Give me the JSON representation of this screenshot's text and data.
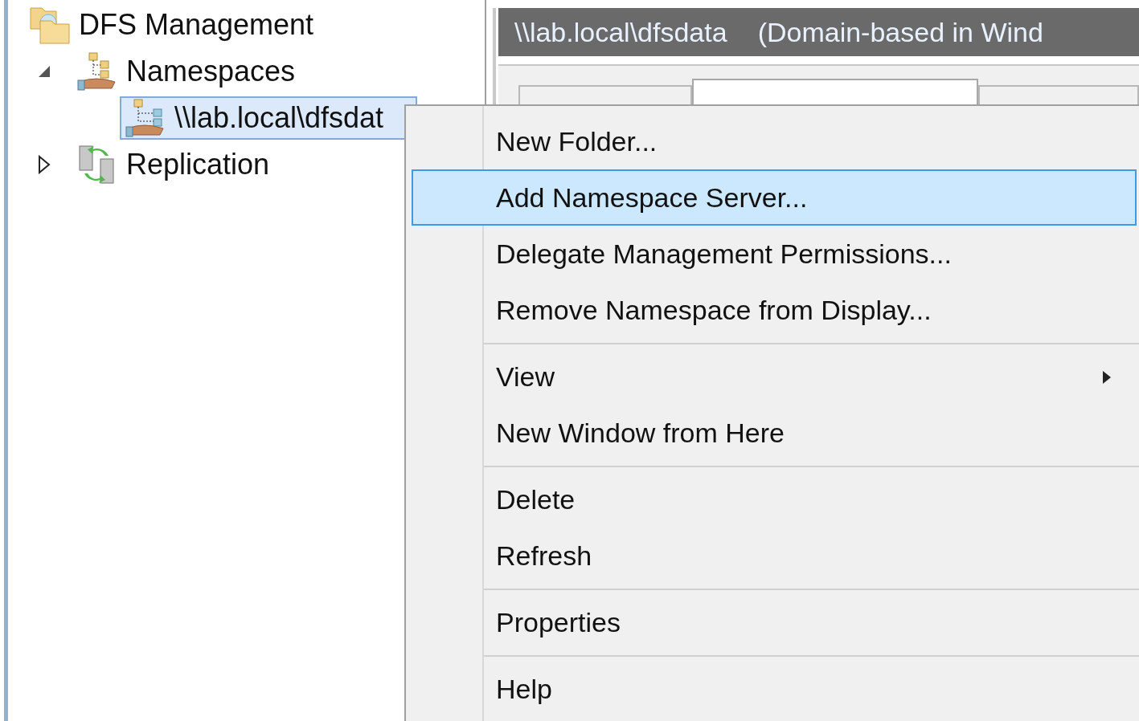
{
  "tree": [
    {
      "label": "DFS Management",
      "kind": "root",
      "children": [
        {
          "label": "Namespaces",
          "kind": "namespaces",
          "expanded": true,
          "selected": false,
          "children": [
            {
              "label": "\\\\lab.local\\dfsdat",
              "kind": "namespace",
              "selected": true
            }
          ]
        },
        {
          "label": "Replication",
          "kind": "replication",
          "expanded": false,
          "selected": false
        }
      ]
    }
  ],
  "detail": {
    "title": "\\\\lab.local\\dfsdata",
    "subtitle": "(Domain-based in Wind",
    "tabs": [
      {
        "selected": false
      },
      {
        "selected": true
      },
      {
        "selected": false
      }
    ]
  },
  "context_menu": [
    {
      "kind": "item",
      "label": "New Folder...",
      "selected": false
    },
    {
      "kind": "item",
      "label": "Add Namespace Server...",
      "selected": true
    },
    {
      "kind": "item",
      "label": "Delegate Management Permissions...",
      "selected": false
    },
    {
      "kind": "item",
      "label": "Remove Namespace from Display...",
      "selected": false
    },
    {
      "kind": "separator"
    },
    {
      "kind": "submenu",
      "label": "View",
      "selected": false
    },
    {
      "kind": "item",
      "label": "New Window from Here",
      "selected": false
    },
    {
      "kind": "separator"
    },
    {
      "kind": "item",
      "label": "Delete",
      "selected": false
    },
    {
      "kind": "item",
      "label": "Refresh",
      "selected": false
    },
    {
      "kind": "separator"
    },
    {
      "kind": "item",
      "label": "Properties",
      "selected": false
    },
    {
      "kind": "separator"
    },
    {
      "kind": "item",
      "label": "Help",
      "selected": false
    }
  ]
}
